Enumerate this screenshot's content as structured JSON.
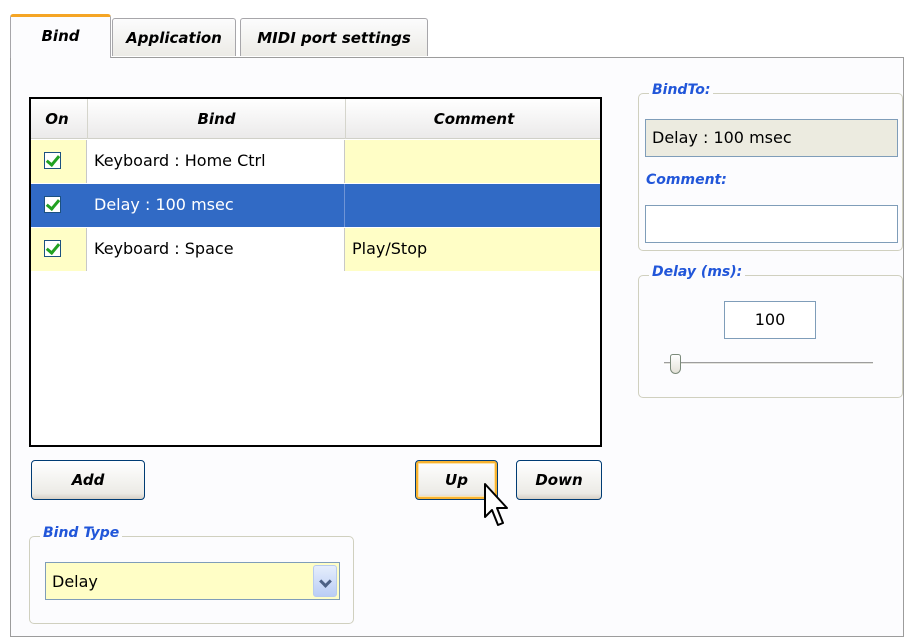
{
  "tabs": [
    {
      "label": "Bind",
      "active": true
    },
    {
      "label": "Application",
      "active": false
    },
    {
      "label": "MIDI port settings",
      "active": false
    }
  ],
  "bind_list": {
    "columns": [
      "On",
      "Bind",
      "Comment"
    ],
    "rows": [
      {
        "on": true,
        "bind": "Keyboard : Home  Ctrl",
        "comment": "",
        "selected": false
      },
      {
        "on": true,
        "bind": "Delay : 100 msec",
        "comment": "",
        "selected": true
      },
      {
        "on": true,
        "bind": "Keyboard : Space",
        "comment": "Play/Stop",
        "selected": false
      }
    ]
  },
  "buttons": {
    "add": "Add",
    "up": "Up",
    "down": "Down"
  },
  "bind_type": {
    "legend": "Bind Type",
    "selected": "Delay"
  },
  "bind_to": {
    "legend": "BindTo:",
    "value": "Delay : 100 msec"
  },
  "comment": {
    "legend": "Comment:",
    "value": ""
  },
  "delay": {
    "legend": "Delay (ms):",
    "value": "100",
    "slider_fraction": 0.03
  },
  "icons": {
    "check": "checkmark-icon",
    "dropdown": "chevron-down-icon",
    "cursor": "mouse-pointer-icon"
  },
  "colors": {
    "selection": "#316ac5",
    "row_highlight": "#fffec6",
    "legend": "#2156d9",
    "tab_accent": "#f5a524",
    "button_hover": "#f8b330"
  }
}
